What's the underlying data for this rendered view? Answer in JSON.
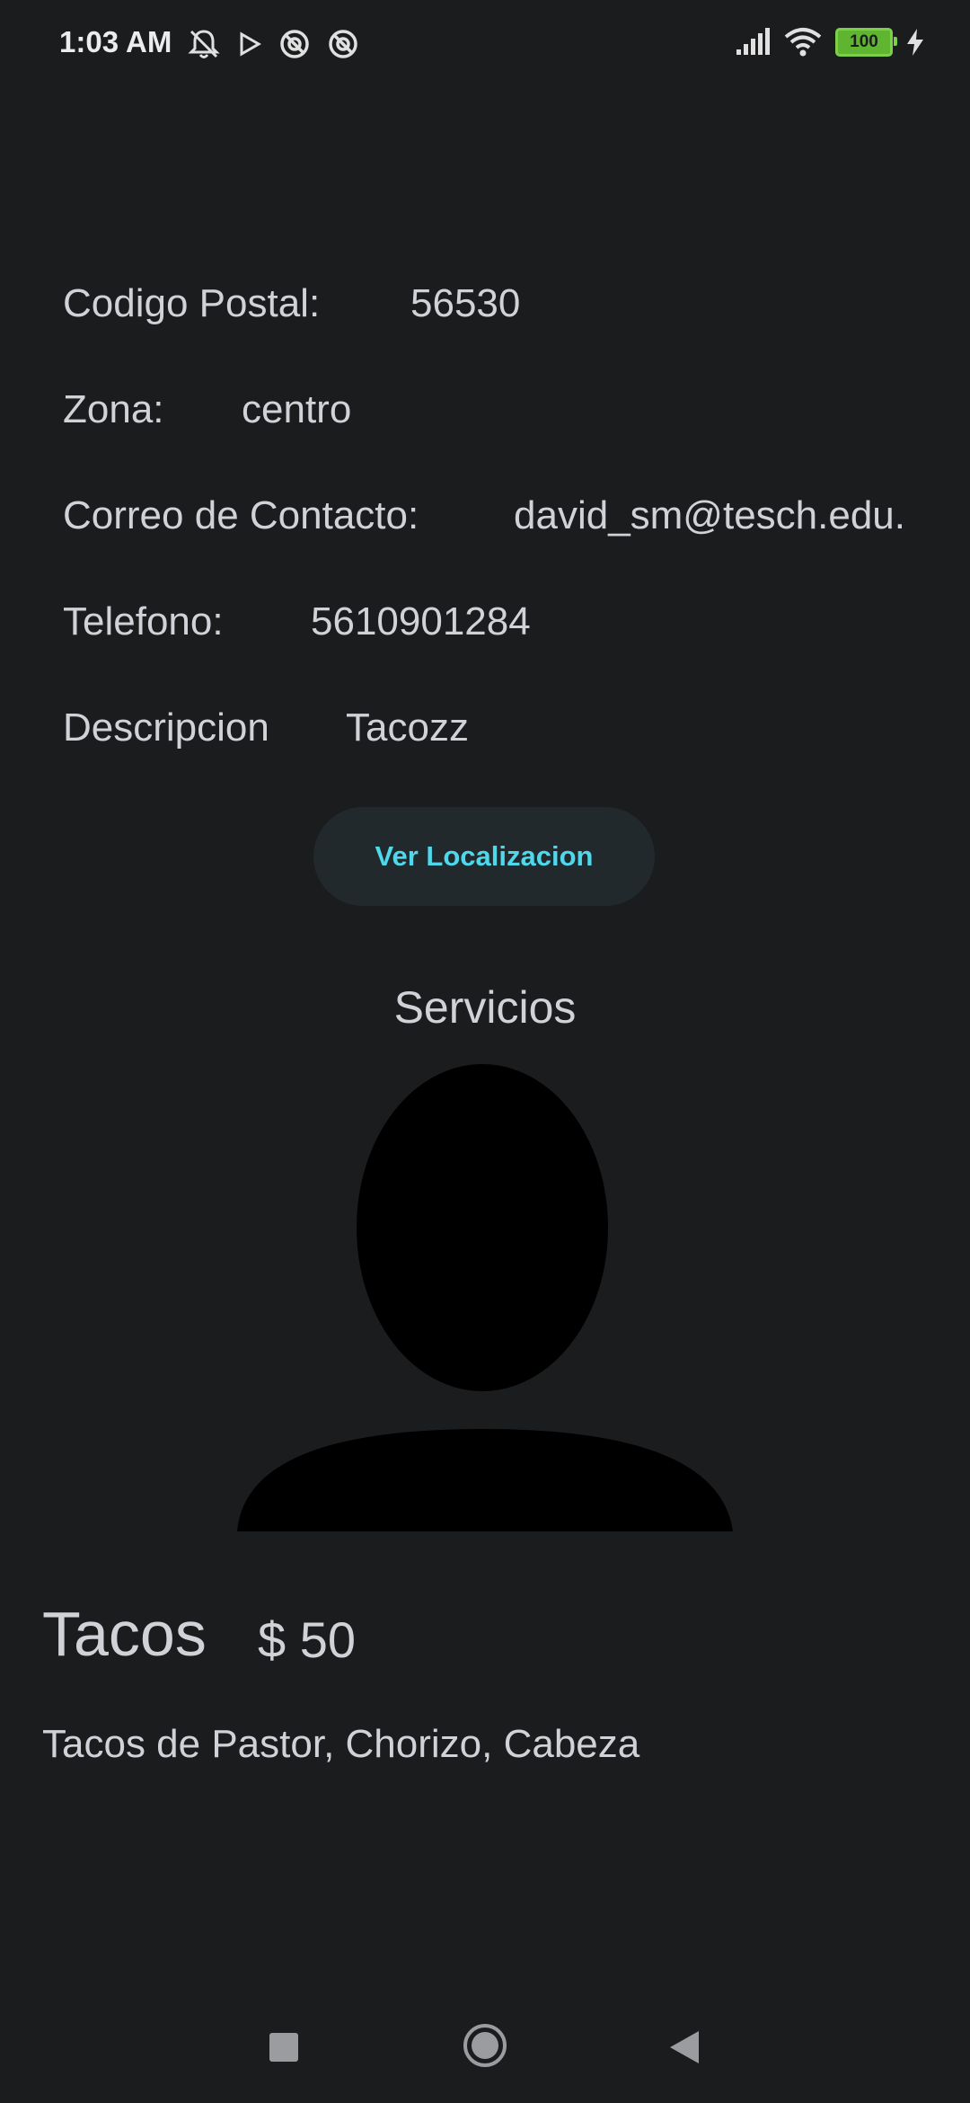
{
  "status_bar": {
    "time": "1:03 AM",
    "battery_level": "100",
    "icons": [
      "mute-icon",
      "play-icon",
      "at-icon",
      "at-icon",
      "signal-icon",
      "wifi-icon",
      "battery-icon",
      "charging-icon"
    ]
  },
  "details": {
    "postal_code_label": "Codigo Postal:",
    "postal_code_value": "56530",
    "zone_label": "Zona:",
    "zone_value": "centro",
    "email_label": "Correo de Contacto:",
    "email_value": "david_sm@tesch.edu.",
    "phone_label": "Telefono:",
    "phone_value": "5610901284",
    "description_label": "Descripcion",
    "description_value": "Tacozz"
  },
  "location_button": {
    "label": "Ver Localizacion"
  },
  "services": {
    "title": "Servicios",
    "item": {
      "name": "Tacos",
      "price": "$ 50",
      "description": "Tacos de Pastor, Chorizo, Cabeza"
    }
  },
  "colors": {
    "background": "#1a1c1e",
    "text": "#d0d2d8",
    "accent": "#4fd8eb",
    "button_bg": "#22292d",
    "battery": "#5fb52f"
  }
}
